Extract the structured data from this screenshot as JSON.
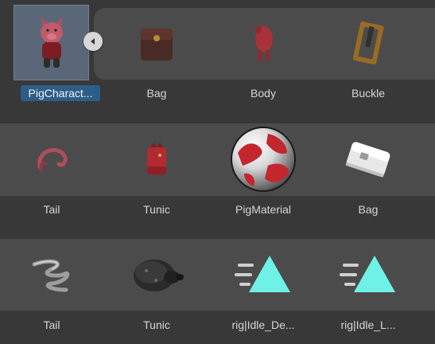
{
  "rows": [
    {
      "items": [
        {
          "label": "PigCharact...",
          "icon": "pig-character-icon",
          "selected": true
        },
        {
          "label": "Bag",
          "icon": "bag-icon"
        },
        {
          "label": "Body",
          "icon": "body-icon"
        },
        {
          "label": "Buckle",
          "icon": "buckle-icon"
        }
      ]
    },
    {
      "items": [
        {
          "label": "Tail",
          "icon": "tail-icon"
        },
        {
          "label": "Tunic",
          "icon": "tunic-icon"
        },
        {
          "label": "PigMaterial",
          "icon": "material-sphere-icon"
        },
        {
          "label": "Bag",
          "icon": "bag-white-icon"
        }
      ]
    },
    {
      "items": [
        {
          "label": "Tail",
          "icon": "tail-spiral-icon"
        },
        {
          "label": "Tunic",
          "icon": "tunic-dark-icon"
        },
        {
          "label": "rig|Idle_De...",
          "icon": "animation-clip-icon"
        },
        {
          "label": "rig|Idle_L...",
          "icon": "animation-clip-icon"
        }
      ]
    }
  ],
  "collapse_button_icon": "collapse-left-icon",
  "colors": {
    "background": "#383838",
    "band": "#4b4b4b",
    "selection": "#2c5d87",
    "anim_accent": "#6ff2e6"
  }
}
